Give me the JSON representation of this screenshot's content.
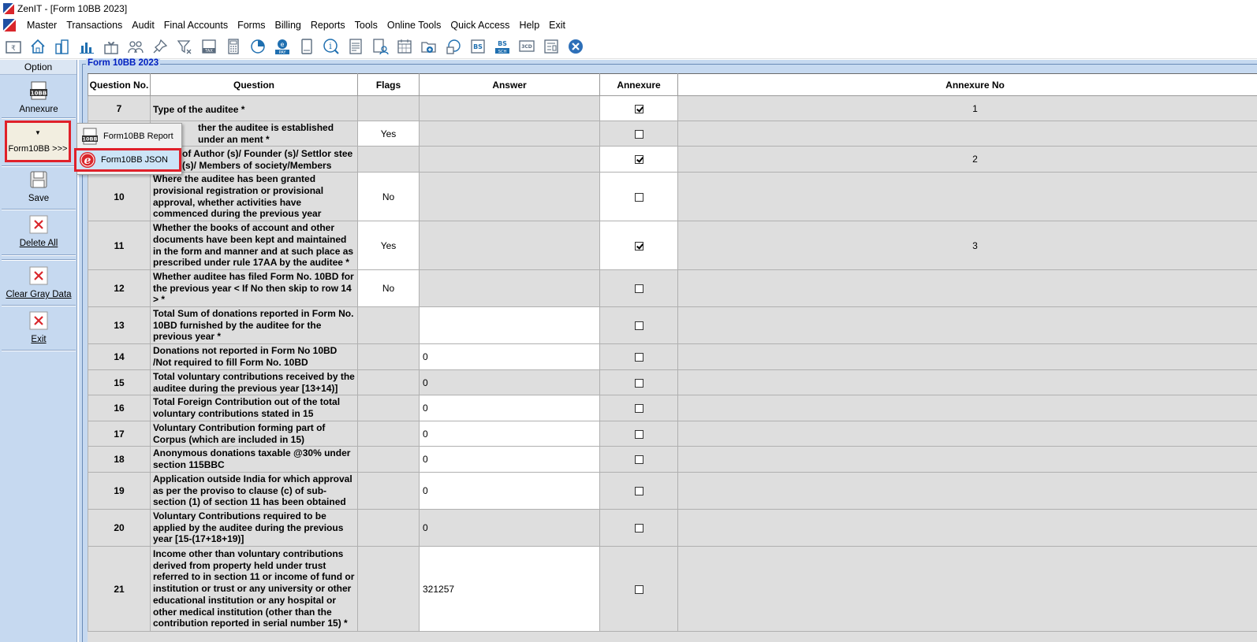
{
  "window": {
    "title": "ZenIT - [Form 10BB 2023]"
  },
  "menu": {
    "items": [
      "Master",
      "Transactions",
      "Audit",
      "Final Accounts",
      "Forms",
      "Billing",
      "Reports",
      "Tools",
      "Online Tools",
      "Quick Access",
      "Help",
      "Exit"
    ]
  },
  "toolbar": {
    "icons": [
      "rupee-folder-icon",
      "home-icon",
      "buildings-icon",
      "bar-chart-icon",
      "gift-icon",
      "users-icon",
      "pin-icon",
      "filter-icon",
      "tax-icon",
      "calculator-icon",
      "pie-chart-icon",
      "epay-icon",
      "ledger-book-icon",
      "info-icon",
      "report-icon",
      "person-document-icon",
      "calendar-icon",
      "add-folder-icon",
      "refresh-search-icon",
      "bs-icon",
      "bs-sch-icon",
      "3cd-icon",
      "form-icon",
      "close-circle-icon"
    ],
    "tax_label": "TAX",
    "pay_label": "PAY",
    "bs_label": "BS",
    "sch_label": "SCH",
    "cd_label": "3CD"
  },
  "left_panel": {
    "option_header": "Option",
    "annexure_badge": "10BB",
    "annexure_label": "Annexure",
    "form10bb_label": "Form10BB >>>",
    "save_label": "Save",
    "delete_all_label": "Delete All",
    "clear_gray_label": "Clear Gray Data",
    "exit_label": "Exit"
  },
  "popup_menu": {
    "item1_badge": "10BB",
    "item1_label": "Form10BB Report",
    "item2_label": "Form10BB JSON"
  },
  "group": {
    "legend": "Form 10BB 2023"
  },
  "grid": {
    "headers": {
      "qno": "Question No.",
      "question": "Question",
      "flags": "Flags",
      "answer": "Answer",
      "annexure": "Annexure",
      "annexure_no": "Annexure No"
    },
    "rows": [
      {
        "no": "7",
        "question": "Type of the auditee *",
        "flag": "",
        "answer": "",
        "annexure": true,
        "annexure_no": "1"
      },
      {
        "no": "",
        "question": "ther the auditee is established under an ment *",
        "flag": "Yes",
        "answer": "",
        "annexure": false,
        "annexure_no": ""
      },
      {
        "no": "",
        "question": "of Author (s)/ Founder (s)/ Settlor stee (s)/ Members of society/Members",
        "flag": "",
        "answer": "",
        "annexure": true,
        "annexure_no": "2"
      },
      {
        "no": "10",
        "question": "Where the auditee has been granted provisional registration or provisional approval, whether activities have commenced during the previous year",
        "flag": "No",
        "answer": "",
        "annexure": false,
        "annexure_no": ""
      },
      {
        "no": "11",
        "question": "Whether the books of account and other documents have been kept and maintained in the form and manner and at such place as prescribed under rule 17AA by the auditee *",
        "flag": "Yes",
        "answer": "",
        "annexure": true,
        "annexure_no": "3"
      },
      {
        "no": "12",
        "question": "Whether auditee has filed Form No. 10BD for the previous year  < If No then skip to row 14 > *",
        "flag": "No",
        "answer": "",
        "annexure": false,
        "annexure_no": ""
      },
      {
        "no": "13",
        "question": "Total Sum of donations reported in Form No. 10BD furnished by the auditee for the previous year *",
        "flag": "",
        "answer": "",
        "annexure": false,
        "annexure_no": ""
      },
      {
        "no": "14",
        "question": "Donations not reported in Form No 10BD /Not required to fill Form No. 10BD",
        "flag": "",
        "answer": "0",
        "annexure": false,
        "annexure_no": ""
      },
      {
        "no": "15",
        "question": "Total voluntary contributions received by the auditee during the previous year [13+14)]",
        "flag": "",
        "answer": "0",
        "annexure": false,
        "annexure_no": ""
      },
      {
        "no": "16",
        "question": "Total Foreign Contribution out of the total voluntary contributions stated in 15",
        "flag": "",
        "answer": "0",
        "annexure": false,
        "annexure_no": ""
      },
      {
        "no": "17",
        "question": "Voluntary Contribution forming part of Corpus (which are included in 15)",
        "flag": "",
        "answer": "0",
        "annexure": false,
        "annexure_no": ""
      },
      {
        "no": "18",
        "question": "Anonymous donations taxable @30% under section 115BBC",
        "flag": "",
        "answer": "0",
        "annexure": false,
        "annexure_no": ""
      },
      {
        "no": "19",
        "question": "Application outside India for which approval as per the proviso to clause (c) of sub-section (1) of section 11 has been obtained",
        "flag": "",
        "answer": "0",
        "annexure": false,
        "annexure_no": ""
      },
      {
        "no": "20",
        "question": "Voluntary Contributions required to be applied by the auditee during the previous year [15-(17+18+19)]",
        "flag": "",
        "answer": "0",
        "annexure": false,
        "annexure_no": ""
      },
      {
        "no": "21",
        "question": "Income other than voluntary contributions derived from property held under trust referred to in section 11 or income of fund or institution or trust or any university or other educational institution or any hospital or other medical institution (other than the contribution reported in serial number 15) *",
        "flag": "",
        "answer": "321257",
        "annexure": false,
        "annexure_no": ""
      }
    ]
  }
}
